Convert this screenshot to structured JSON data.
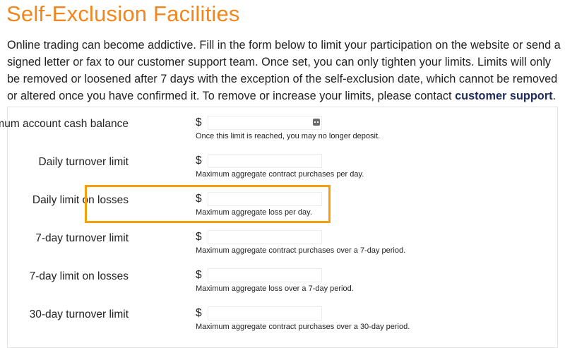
{
  "page": {
    "title": "Self-Exclusion Facilities",
    "intro_text": "Online trading can become addictive. Fill in the form below to limit your participation on the website or send a signed letter or fax to our customer support team. Once set, you can only tighten your limits. Limits will only be removed or loosened after 7 days with the exception of the self-exclusion date, which cannot be removed or altered once you have confirmed it. To remove or increase your limits, please contact ",
    "intro_link": "customer support",
    "intro_end": "."
  },
  "form": {
    "currency_symbol": "$",
    "rows": [
      {
        "label": "Maximum account cash balance",
        "value": "",
        "hint": "Once this limit is reached, you may no longer deposit."
      },
      {
        "label": "Daily turnover limit",
        "value": "",
        "hint": "Maximum aggregate contract purchases per day."
      },
      {
        "label": "Daily limit on losses",
        "value": "",
        "hint": "Maximum aggregate loss per day."
      },
      {
        "label": "7-day turnover limit",
        "value": "",
        "hint": "Maximum aggregate contract purchases over a 7-day period."
      },
      {
        "label": "7-day limit on losses",
        "value": "",
        "hint": "Maximum aggregate loss over a 7-day period."
      },
      {
        "label": "30-day turnover limit",
        "value": "",
        "hint": "Maximum aggregate contract purchases over a 30-day period."
      }
    ]
  },
  "colors": {
    "title": "#f2861d",
    "highlight": "#f59f0c",
    "link": "#1f2a5c"
  },
  "icons": {
    "autofill": "autofill-icon"
  }
}
